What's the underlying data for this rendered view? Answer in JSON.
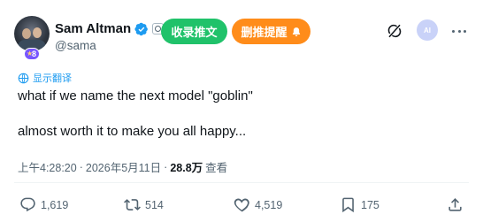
{
  "author": {
    "display_name": "Sam Altman",
    "handle": "@sama",
    "level_badge": "8",
    "verified_color": "#1d9bf0"
  },
  "header_buttons": {
    "favorite_label": "收录推文",
    "favorite_color": "#20c26a",
    "remind_label": "删推提醒",
    "remind_color": "#ff8c1a"
  },
  "icons": [
    "grok-icon",
    "ai-icon",
    "more-icon",
    "bell-icon",
    "translate-icon",
    "reply-icon",
    "retweet-icon",
    "like-icon",
    "bookmark-icon",
    "share-icon"
  ],
  "translate_label": "显示翻译",
  "tweet": {
    "line1": "what if we name the next model \"goblin\"",
    "line2": "almost worth it to make you all happy..."
  },
  "meta": {
    "time": "上午4:28:20",
    "separator": "·",
    "date": "2026年5月11日",
    "views_count": "28.8万",
    "views_label": "查看"
  },
  "actions": {
    "replies": "1,619",
    "retweets": "514",
    "likes": "4,519",
    "bookmarks": "175"
  }
}
